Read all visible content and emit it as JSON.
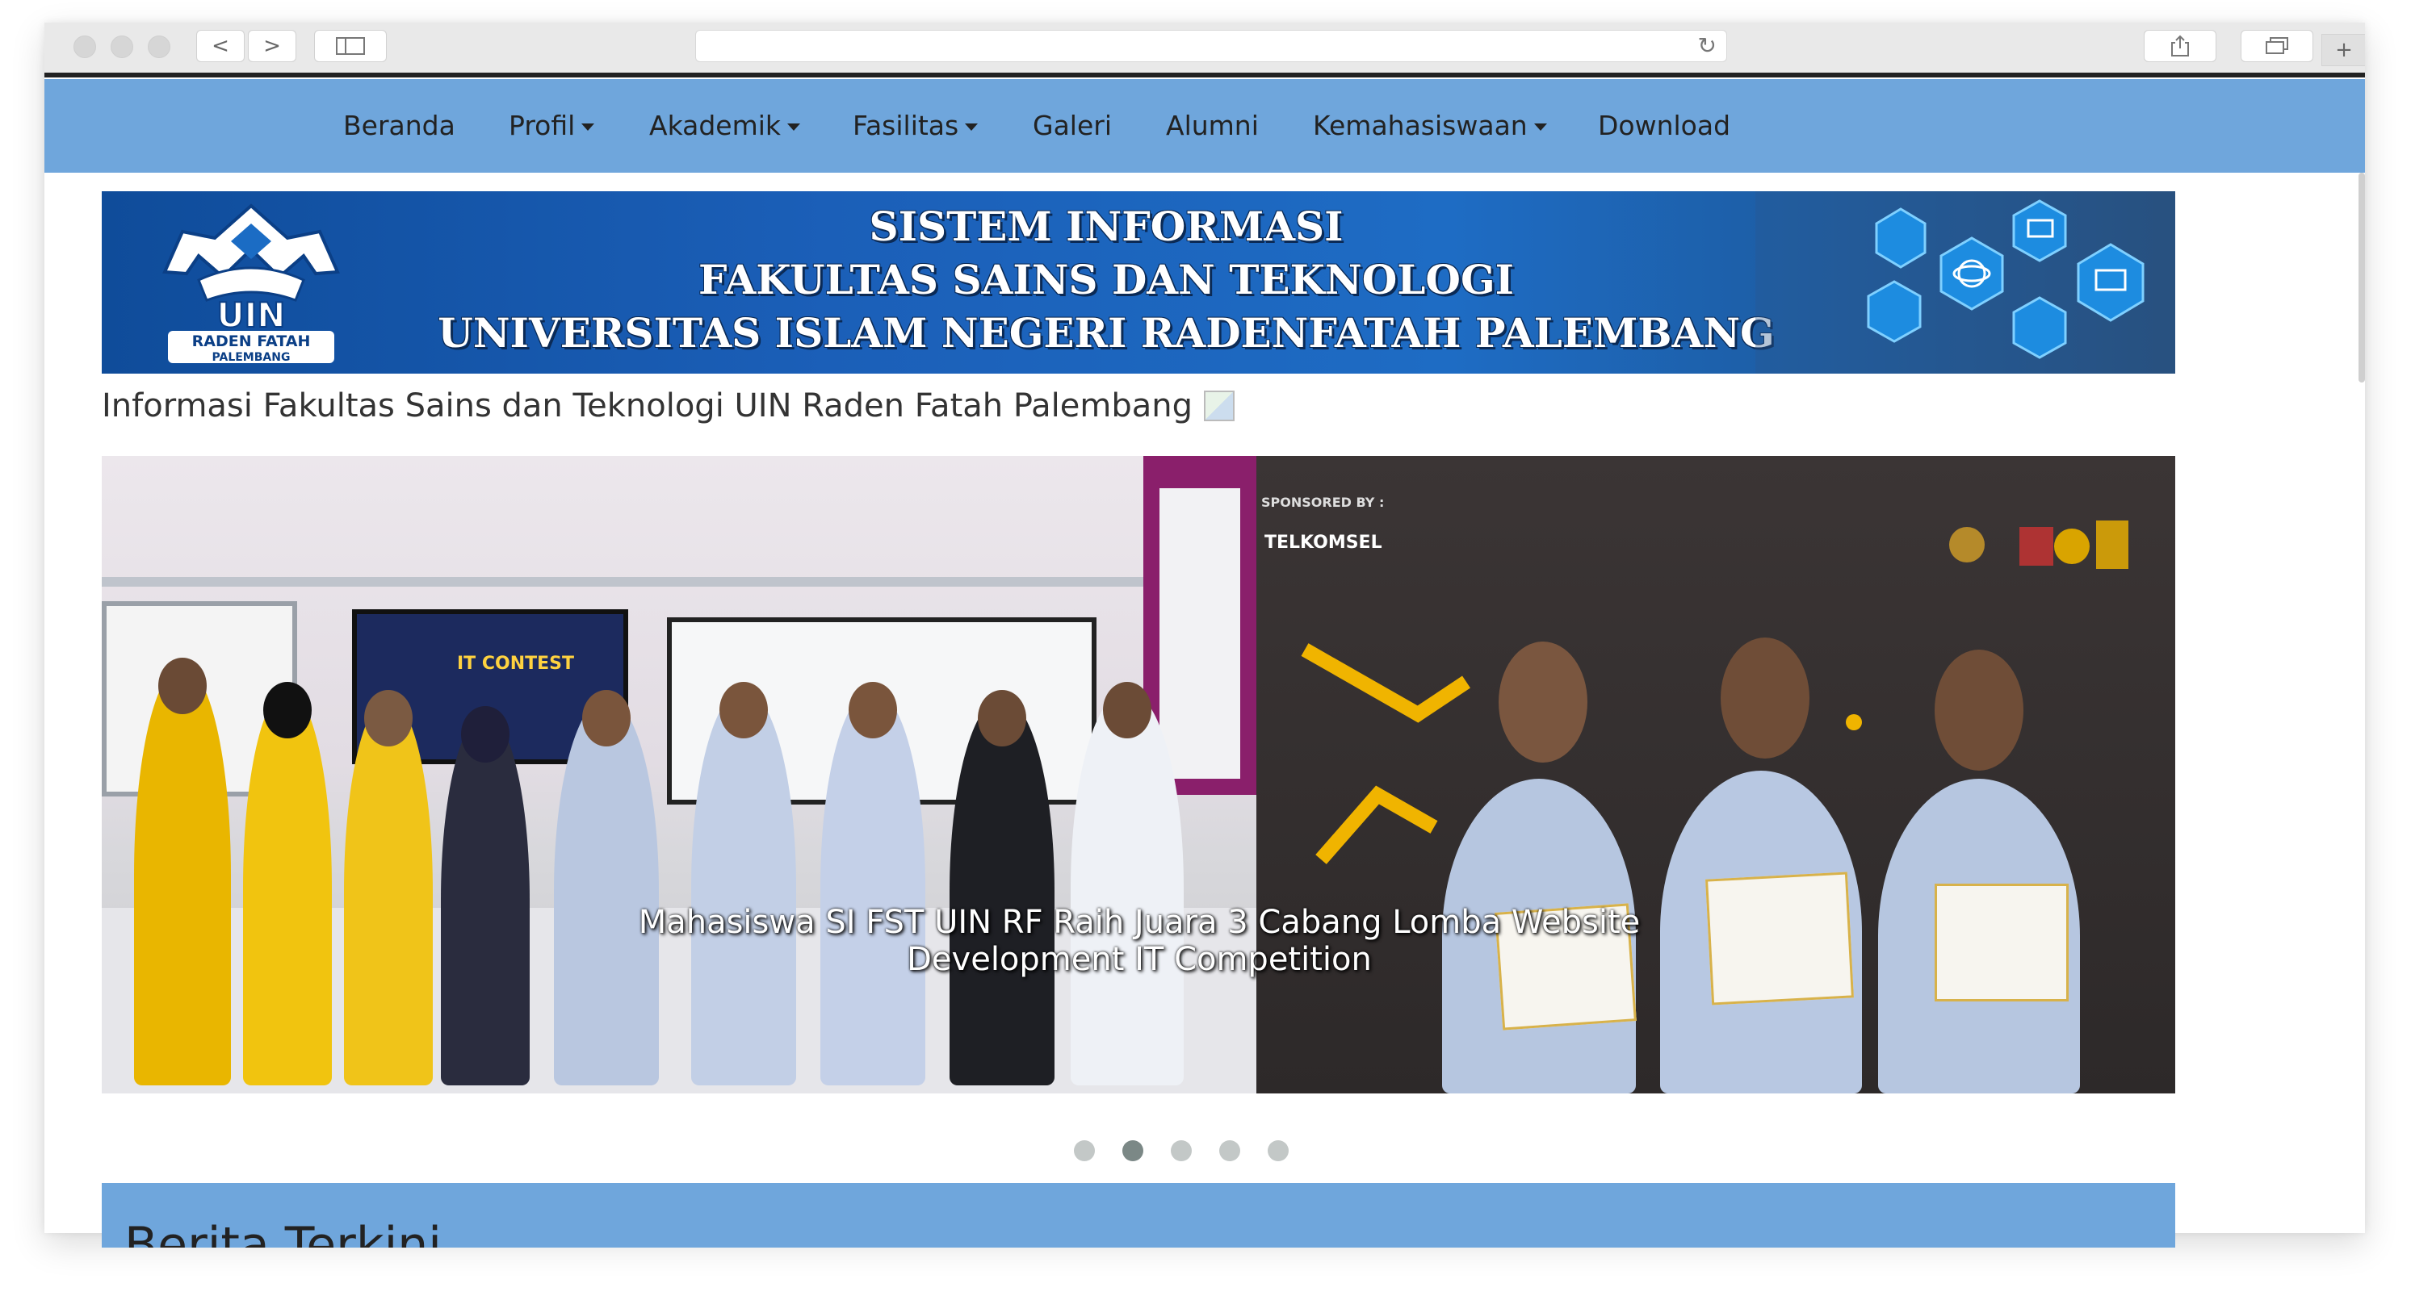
{
  "browser": {
    "back_icon": "<",
    "forward_icon": ">",
    "reload_icon": "↻",
    "new_tab_icon": "+"
  },
  "nav": {
    "items": [
      {
        "label": "Beranda",
        "dropdown": false
      },
      {
        "label": "Profil",
        "dropdown": true
      },
      {
        "label": "Akademik",
        "dropdown": true
      },
      {
        "label": "Fasilitas",
        "dropdown": true
      },
      {
        "label": "Galeri",
        "dropdown": false
      },
      {
        "label": "Alumni",
        "dropdown": false
      },
      {
        "label": "Kemahasiswaan",
        "dropdown": true
      },
      {
        "label": "Download",
        "dropdown": false
      }
    ]
  },
  "banner": {
    "line1": "SISTEM INFORMASI",
    "line2": "FAKULTAS SAINS DAN TEKNOLOGI",
    "line3": "UNIVERSITAS ISLAM NEGERI RADENFATAH PALEMBANG",
    "logo_text": "UIN",
    "logo_sub1": "RADEN FATAH",
    "logo_sub2": "PALEMBANG"
  },
  "subtitle": "Informasi Fakultas Sains dan Teknologi UIN Raden Fatah Palembang",
  "carousel": {
    "caption_line1": "Mahasiswa SI FST UIN RF Raih Juara 3 Cabang Lomba Website",
    "caption_line2": "Development IT Competition",
    "sponsor_label": "SPONSORED BY :",
    "sponsor_name": "TELKOMSEL",
    "screen_title": "IT CONTEST",
    "slide_count": 5,
    "active_index": 1
  },
  "section": {
    "title": "Berita Terkini"
  },
  "colors": {
    "nav_bg": "#6fa6dc",
    "banner_bg": "#1b5fb8",
    "indicator": "#c3c8c7",
    "indicator_active": "#7b8886"
  }
}
